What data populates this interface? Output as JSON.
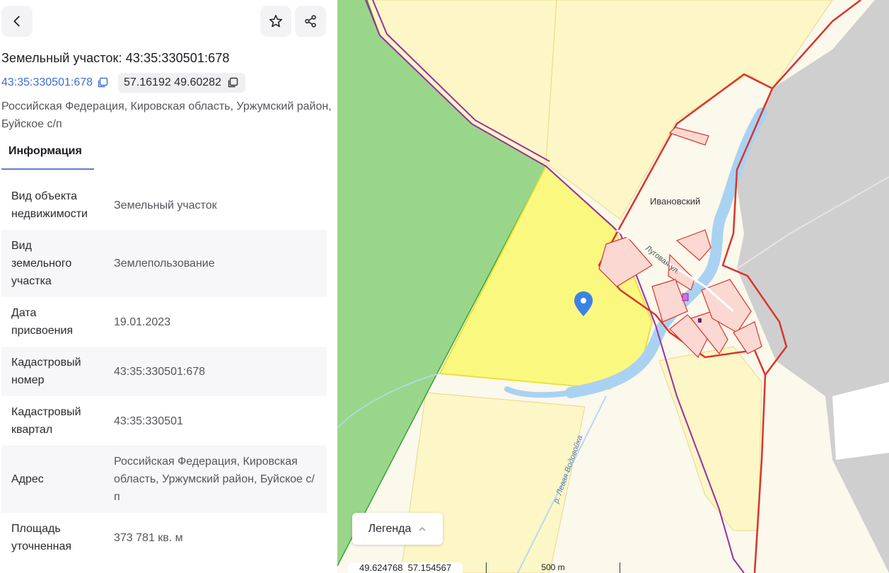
{
  "header": {
    "title": "Земельный участок: 43:35:330501:678",
    "cadastral_link": "43:35:330501:678",
    "coordinates": "57.16192 49.60282",
    "address": "Российская Федерация, Кировская область, Уржумский район, Буйское с/п"
  },
  "tabs": [
    {
      "label": "Информация"
    }
  ],
  "info_rows": [
    {
      "key": "Вид объекта недвижимости",
      "value": "Земельный участок"
    },
    {
      "key": "Вид земельного участка",
      "value": "Землепользование"
    },
    {
      "key": "Дата присвоения",
      "value": "19.01.2023"
    },
    {
      "key": "Кадастровый номер",
      "value": "43:35:330501:678"
    },
    {
      "key": "Кадастровый квартал",
      "value": "43:35:330501"
    },
    {
      "key": "Адрес",
      "value": "Российская Федерация, Кировская область, Уржумский район, Буйское с/п"
    },
    {
      "key": "Площадь уточненная",
      "value": "373 781 кв. м"
    }
  ],
  "map": {
    "place_label": "Ивановский",
    "street_label": "Луговая ул.",
    "river_label": "р. Левая Водовойка",
    "legend_label": "Легенда",
    "cursor_coords": "49.624768  57.154567",
    "scale_label": "500 m"
  },
  "colors": {
    "accent": "#3b6fd8",
    "forest": "#9ad68a",
    "selected_parcel": "#fbf880",
    "field_parcel": "#fdf6c6",
    "boundary_red": "#d9352b",
    "water": "#a9d2f2",
    "marker": "#3b82e6"
  },
  "icons": [
    "back-icon",
    "star-icon",
    "share-icon",
    "copy-icon",
    "chevron-up-icon",
    "location-pin-icon"
  ]
}
